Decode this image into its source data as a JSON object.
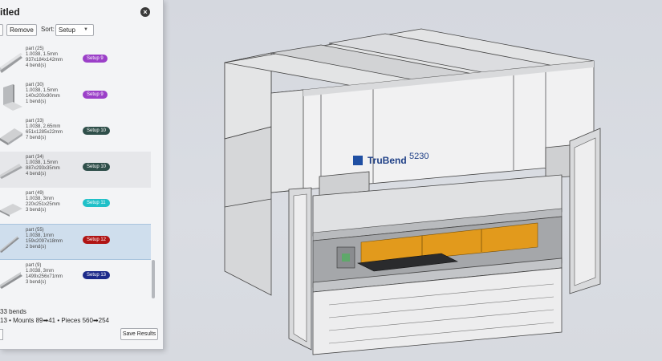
{
  "panel": {
    "title": "itled",
    "close_glyph": "×",
    "remove_label": "Remove",
    "sort_label": "Sort:",
    "sort_value": "Setup",
    "summary_line1": "33 bends",
    "summary_line2": "13  •  Mounts 89➡41  •  Pieces 560➡254",
    "save_label": "Save Results"
  },
  "items": [
    {
      "name": "part (25)",
      "material": "1.0038, 1.5mm",
      "dims": "937x184x142mm",
      "bends": "4 bend(s)",
      "setup": "Setup 9",
      "color": "#9b3fc8",
      "thumb": "angle-long-icon"
    },
    {
      "name": "part (30)",
      "material": "1.0038, 1.5mm",
      "dims": "140x200x90mm",
      "bends": "1 bend(s)",
      "setup": "Setup 9",
      "color": "#9b3fc8",
      "thumb": "bracket-icon"
    },
    {
      "name": "part (33)",
      "material": "1.0038, 2.65mm",
      "dims": "651x1285x22mm",
      "bends": "7 bend(s)",
      "setup": "Setup 10",
      "color": "#2f4f4a",
      "thumb": "tray-icon"
    },
    {
      "name": "part (34)",
      "material": "1.0038, 1.5mm",
      "dims": "887x293x35mm",
      "bends": "4 bend(s)",
      "setup": "Setup 10",
      "color": "#2f4f4a",
      "thumb": "channel-icon"
    },
    {
      "name": "part (49)",
      "material": "1.0038, 3mm",
      "dims": "220x251x25mm",
      "bends": "3 bend(s)",
      "setup": "Setup 11",
      "color": "#1fc0c8",
      "thumb": "plate-icon"
    },
    {
      "name": "part (55)",
      "material": "1.0038, 1mm",
      "dims": "159x2097x18mm",
      "bends": "2 bend(s)",
      "setup": "Setup 12",
      "color": "#b01414",
      "thumb": "strip-icon"
    },
    {
      "name": "part (9)",
      "material": "1.0038, 3mm",
      "dims": "1499x256x71mm",
      "bends": "3 bend(s)",
      "setup": "Setup 13",
      "color": "#1c2a8a",
      "thumb": "rail-icon"
    }
  ],
  "machine": {
    "brand": "TruBend",
    "model": "5230"
  }
}
